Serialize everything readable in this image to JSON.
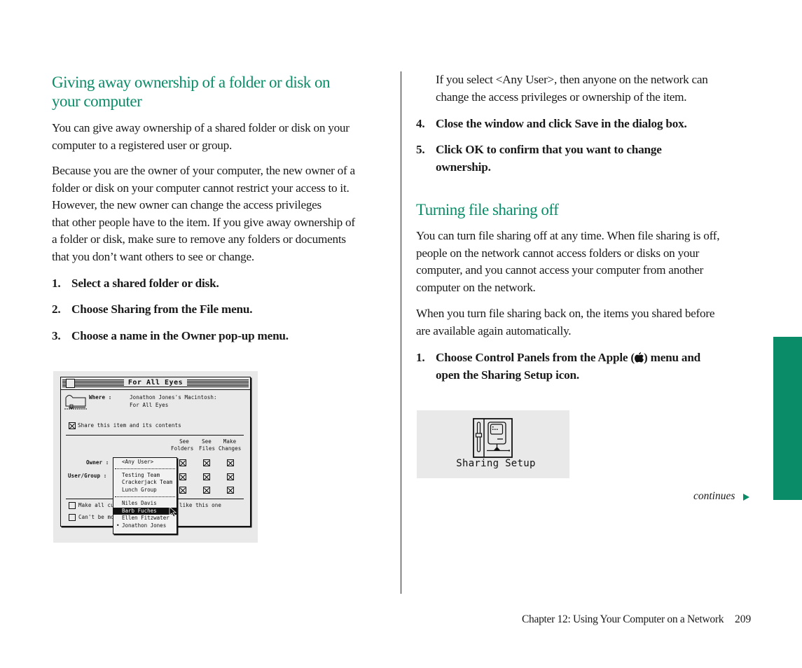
{
  "colors": {
    "accent": "#0a8c68",
    "text": "#1a1a1a",
    "screenshot_bg": "#e9e9e9"
  },
  "left": {
    "heading_line1": "Giving away ownership of a folder or disk on",
    "heading_line2": "your computer",
    "para1_lines": [
      "You can give away ownership of a shared folder or disk on your",
      "computer to a registered user or group."
    ],
    "para2_lines": [
      "Because you are the owner of your computer, the new owner of a",
      "folder or disk on your computer cannot restrict your access to it.",
      "However, the new owner can change the access privileges",
      "that other people have to the item. If you give away ownership of",
      "a folder or disk, make sure to remove any folders or documents",
      "that you don’t want others to see or change."
    ],
    "steps": [
      {
        "num": "1.",
        "text": "Select a shared folder or disk."
      },
      {
        "num": "2.",
        "text": "Choose Sharing from the File menu."
      },
      {
        "num": "3.",
        "text": "Choose a name in the Owner pop-up menu."
      }
    ]
  },
  "dialog": {
    "window_title": "For All Eyes",
    "where_label": "Where :",
    "where_value_line1": "Jonathon Jones's Macintosh:",
    "where_value_line2": "For All Eyes",
    "share_checkbox_label": "Share this item and its contents",
    "share_checked": true,
    "columns": [
      {
        "line1": "See",
        "line2": "Folders"
      },
      {
        "line1": "See",
        "line2": "Files"
      },
      {
        "line1": "Make",
        "line2": "Changes"
      }
    ],
    "owner_label": "Owner :",
    "user_group_label": "User/Group :",
    "privilege_rows_checked": [
      [
        true,
        true,
        true
      ],
      [
        true,
        true,
        true
      ],
      [
        true,
        true,
        true
      ]
    ],
    "make_all_label_visible": "Make all cur",
    "make_all_label_tail": "like this one",
    "make_all_checked": false,
    "cant_move_label_visible": "Can't be mo",
    "cant_move_checked": false,
    "popup_menu": {
      "items": [
        {
          "label": "<Any User>",
          "group": 0
        },
        {
          "label": "Testing Team",
          "group": 1
        },
        {
          "label": "Crackerjack Team",
          "group": 1
        },
        {
          "label": "Lunch Group",
          "group": 1
        },
        {
          "label": "Niles Davis",
          "group": 2
        },
        {
          "label": "Barb Fuches",
          "group": 2,
          "highlighted": true
        },
        {
          "label": "Ellen Fitzwater",
          "group": 2
        },
        {
          "label": "Jonathon Jones",
          "group": 2,
          "current": true
        }
      ],
      "current_marker": "•"
    }
  },
  "right": {
    "para_anyuser_lines": [
      "If you select <Any User>, then anyone on the network can",
      "change the access privileges or ownership of the item."
    ],
    "steps_a": [
      {
        "num": "4.",
        "lines": [
          "Close the window and click Save in the dialog box."
        ]
      },
      {
        "num": "5.",
        "lines": [
          "Click OK to confirm that you want to change",
          "ownership."
        ]
      }
    ],
    "heading": "Turning file sharing off",
    "para1_lines": [
      "You can turn file sharing off at any time. When file sharing is off,",
      "people on the network cannot access folders or disks on your",
      "computer, and you cannot access your computer from another",
      "computer on the network."
    ],
    "para2_lines": [
      "When you turn file sharing back on, the items you shared before",
      "are available again automatically."
    ],
    "step_b": {
      "num": "1.",
      "line1": "Choose Control Panels from the Apple () menu and",
      "line1_pre": "Choose Control Panels from the Apple (",
      "apple_glyph": "",
      "line1_post": ") menu and",
      "line2": "open the Sharing Setup icon."
    },
    "icon_label": "Sharing Setup",
    "continues": "continues"
  },
  "footer": {
    "chapter": "Chapter 12: Using Your Computer on a Network",
    "page": "209"
  }
}
